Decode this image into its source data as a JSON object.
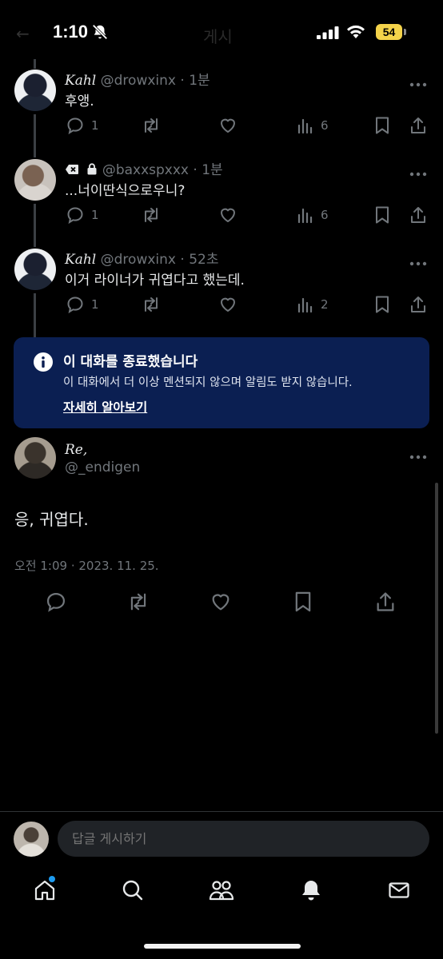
{
  "status_bar": {
    "time": "1:10",
    "battery": "54",
    "faded_title": "게시",
    "faded_back": "←"
  },
  "thread": [
    {
      "name": "Kahl",
      "handle": "@drowxinx",
      "time": "1분",
      "text": "후앵.",
      "replies": "1",
      "views": "6"
    },
    {
      "name": "",
      "handle": "@baxxspxxx",
      "time": "1분",
      "text": "...너이딴식으로우니?",
      "replies": "1",
      "views": "6"
    },
    {
      "name": "Kahl",
      "handle": "@drowxinx",
      "time": "52초",
      "text": "이거 라이너가 귀엽다고 했는데.",
      "replies": "1",
      "views": "2"
    }
  ],
  "notice": {
    "title": "이 대화를 종료했습니다",
    "body": "이 대화에서 더 이상 멘션되지 않으며 알림도 받지 않습니다.",
    "link": "자세히 알아보기"
  },
  "main_tweet": {
    "name": "Re,",
    "handle": "@_endigen",
    "text": "응, 귀엽다.",
    "timestamp": "오전 1:09 · 2023. 11. 25."
  },
  "reply": {
    "placeholder": "답글 게시하기"
  },
  "nav": {
    "items": [
      "home-icon",
      "search-icon",
      "communities-icon",
      "notifications-icon",
      "messages-icon"
    ],
    "accent": "#1d9bf0"
  }
}
